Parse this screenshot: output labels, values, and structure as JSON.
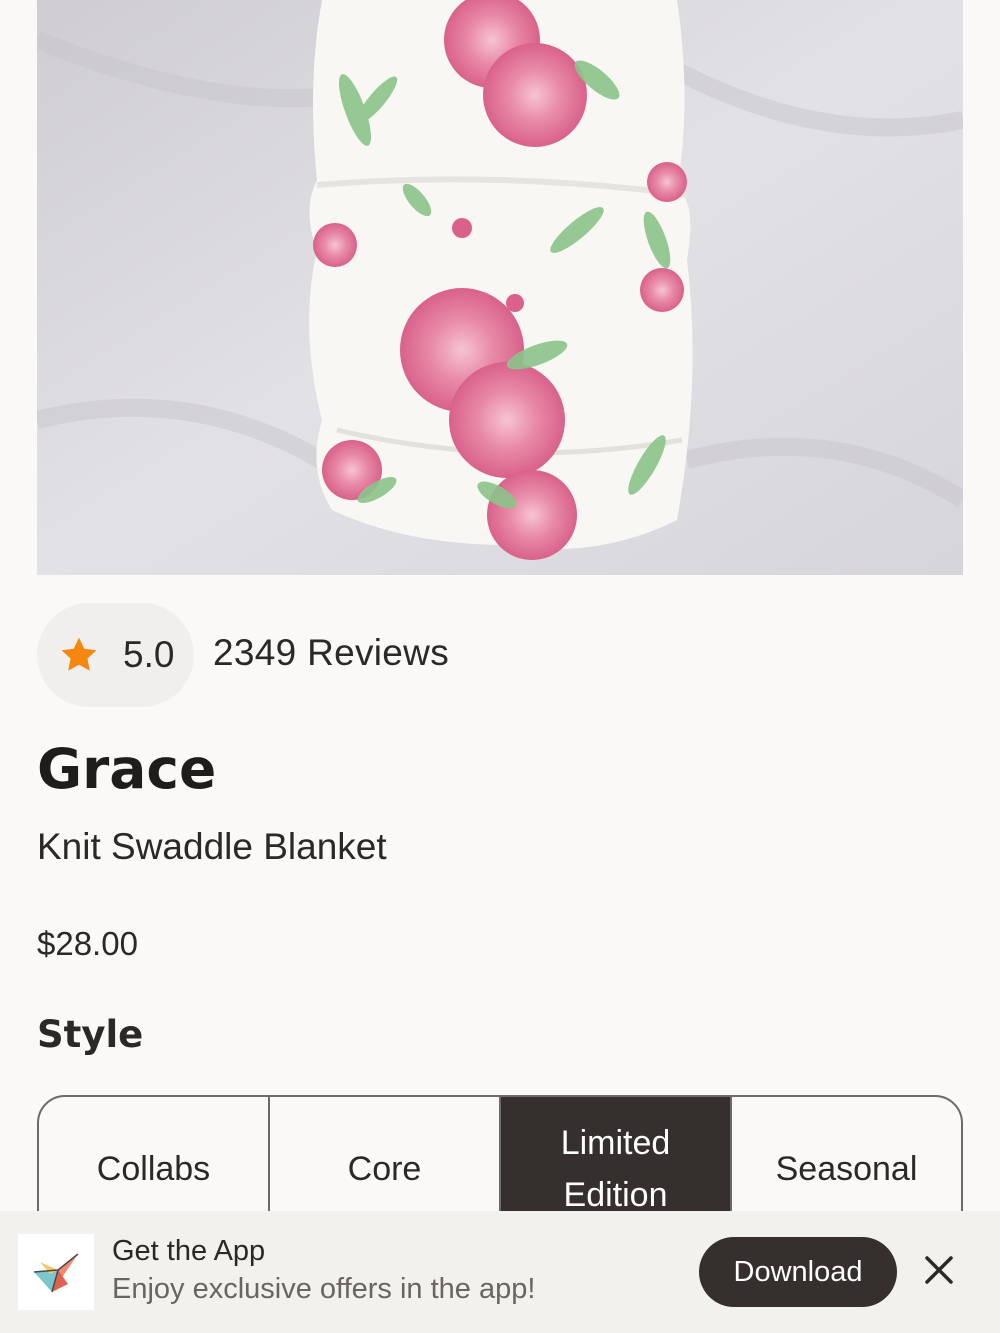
{
  "product": {
    "image_alt": "",
    "rating": "5.0",
    "reviews": "2349 Reviews",
    "name": "Grace",
    "subtitle": "Knit Swaddle Blanket",
    "price": "$28.00"
  },
  "style": {
    "heading": "Style",
    "options": [
      {
        "label": "Collabs",
        "selected": false
      },
      {
        "label": "Core",
        "selected": false
      },
      {
        "label": "Limited Edition",
        "selected": true
      },
      {
        "label": "Seasonal",
        "selected": false
      }
    ]
  },
  "app_banner": {
    "title": "Get the App",
    "description": "Enjoy exclusive offers in the app!",
    "download_label": "Download",
    "logo_icon": "paper-crane-icon",
    "close_icon": "close-icon"
  },
  "colors": {
    "star": "#f5870f",
    "dark": "#35302d",
    "background": "#faf9f7"
  },
  "icons": {
    "rating": "star-icon"
  }
}
